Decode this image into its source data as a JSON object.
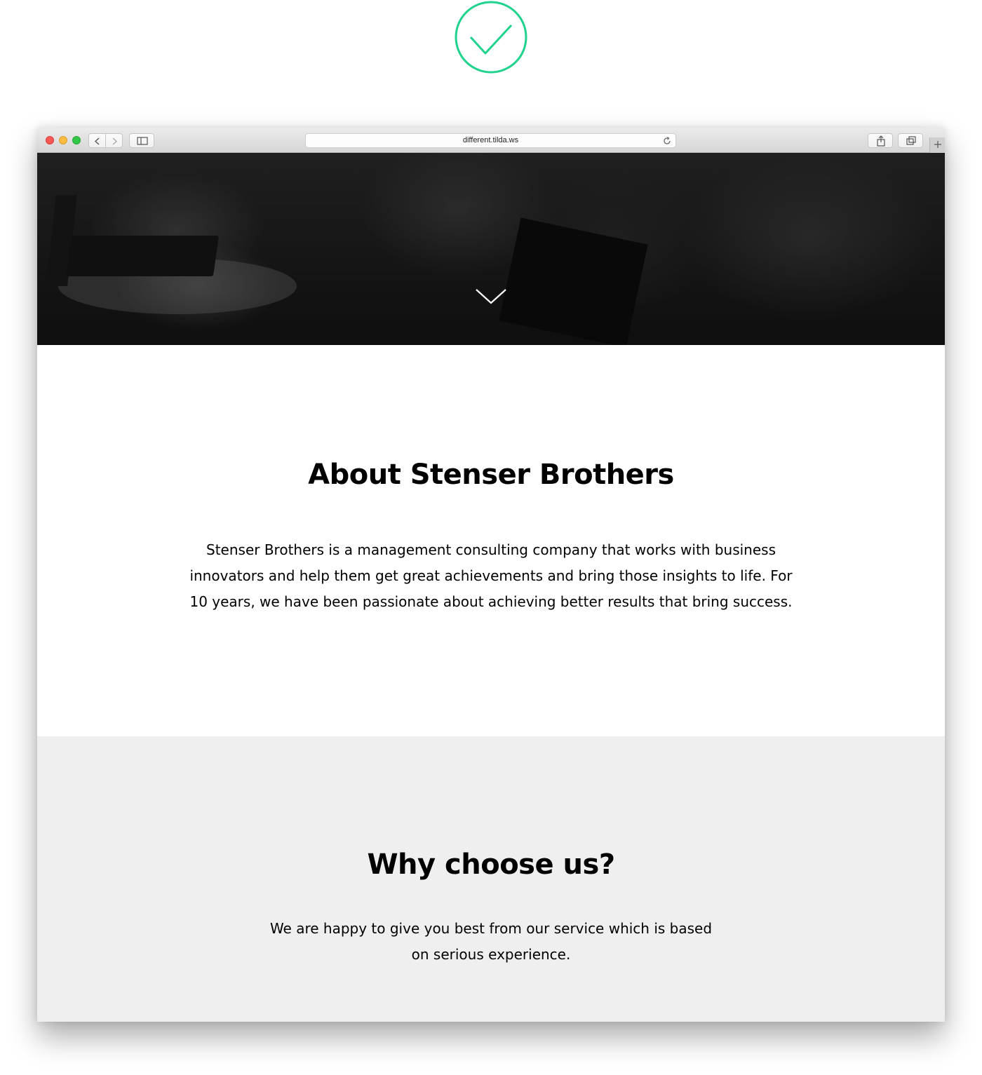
{
  "status_icon": "checkmark-icon",
  "colors": {
    "check_green": "#1fd38d",
    "hero_overlay": "#1a1a1a",
    "why_bg": "#efefef"
  },
  "browser": {
    "url": "different.tilda.ws",
    "icons": [
      "back-icon",
      "forward-icon",
      "sidebar-icon",
      "reload-icon",
      "share-icon",
      "tabs-icon",
      "plus-icon"
    ]
  },
  "hero": {
    "scroll_icon": "chevron-down-icon"
  },
  "about": {
    "title": "About Stenser Brothers",
    "text": "Stenser Brothers is a management consulting company that works with business innovators and help them get great achievements and bring those insights to life. For 10 years, we have been passionate about achieving better results that bring success."
  },
  "why": {
    "title": "Why choose us?",
    "text": "We are happy to give you best from our service which is based on serious experience."
  }
}
